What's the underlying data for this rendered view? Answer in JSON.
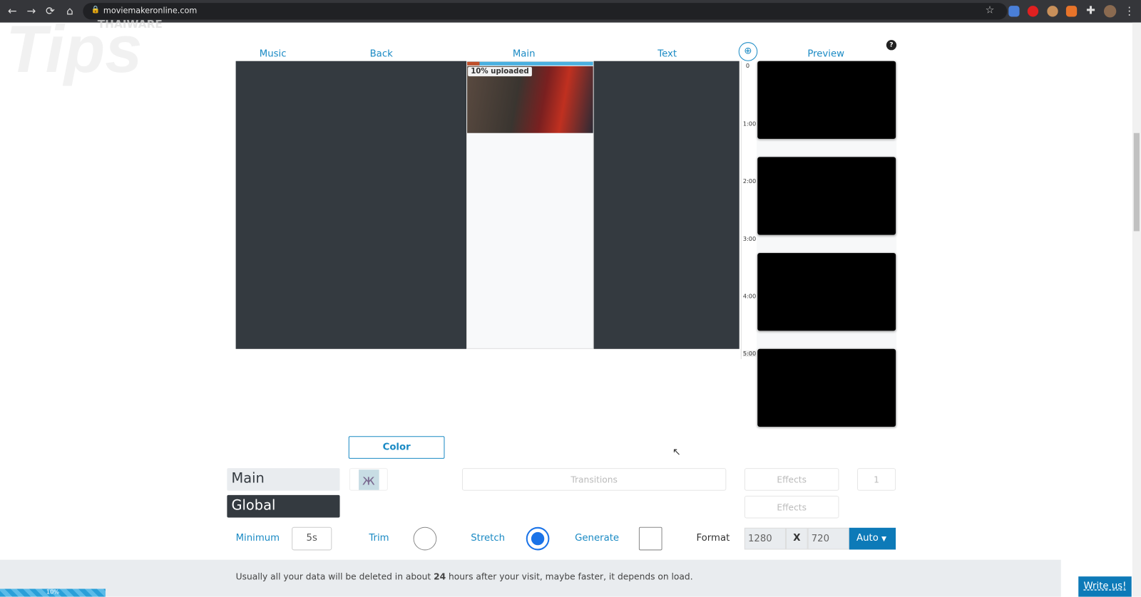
{
  "browser": {
    "url": "moviemakeronline.com"
  },
  "watermark": {
    "brand": "THAIWARE",
    "text": "tips"
  },
  "tracks": {
    "music": "Music",
    "back": "Back",
    "main": "Main",
    "text": "Text",
    "preview": "Preview"
  },
  "upload": {
    "status": "10% uploaded",
    "progress": 0.1
  },
  "ruler": [
    "0",
    "1:00",
    "2:00",
    "3:00",
    "4:00",
    "5:00"
  ],
  "controls": {
    "color_button": "Color",
    "main_tab": "Main",
    "global_tab": "Global",
    "transitions": "Transitions",
    "effects_main": "Effects",
    "effects_global": "Effects",
    "count": "1",
    "minimum_label": "Minimum",
    "minimum_value": "5s",
    "trim_label": "Trim",
    "stretch_label": "Stretch",
    "generate_label": "Generate",
    "format_label": "Format",
    "width": "1280",
    "x": "X",
    "height": "720",
    "auto": "Auto"
  },
  "footer": {
    "line1_pre": "Usually all your data will be deleted in about ",
    "line1_bold": "24",
    "line1_post": " hours after your visit, maybe faster, it depends on load.",
    "write_us": "Write us!",
    "progress_label": "10%"
  },
  "colors": {
    "accent": "#1a8ac4",
    "primary": "#0d7ab8",
    "dark": "#343a40"
  }
}
